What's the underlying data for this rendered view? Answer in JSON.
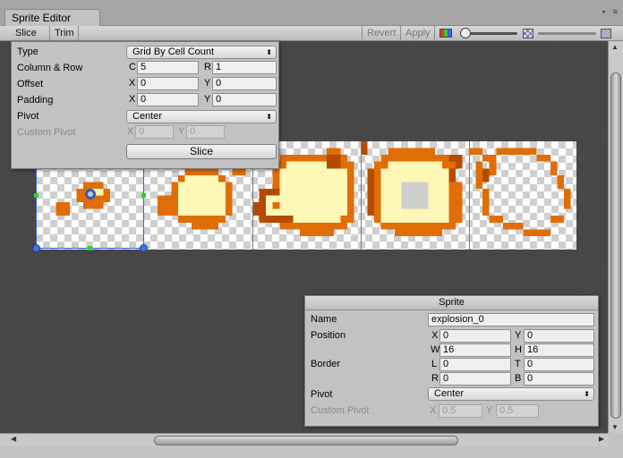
{
  "window": {
    "tab_title": "Sprite Editor"
  },
  "toolbar": {
    "slice_label": "Slice",
    "slice_arrow": "⬍",
    "trim_label": "Trim",
    "revert_label": "Revert",
    "apply_label": "Apply"
  },
  "slice_panel": {
    "type_label": "Type",
    "type_value": "Grid By Cell Count",
    "colrow_label": "Column & Row",
    "c_label": "C",
    "c_value": "5",
    "r_label": "R",
    "r_value": "1",
    "offset_label": "Offset",
    "offset_x_label": "X",
    "offset_x": "0",
    "offset_y_label": "Y",
    "offset_y": "0",
    "padding_label": "Padding",
    "padding_x_label": "X",
    "padding_x": "0",
    "padding_y_label": "Y",
    "padding_y": "0",
    "pivot_label": "Pivot",
    "pivot_value": "Center",
    "custom_pivot_label": "Custom Pivot",
    "cp_x_label": "X",
    "cp_x": "0",
    "cp_y_label": "Y",
    "cp_y": "0",
    "slice_button": "Slice"
  },
  "sprite_panel": {
    "title": "Sprite",
    "name_label": "Name",
    "name_value": "explosion_0",
    "position_label": "Position",
    "x_label": "X",
    "x_value": "0",
    "y_label": "Y",
    "y_value": "0",
    "w_label": "W",
    "w_value": "16",
    "h_label": "H",
    "h_value": "16",
    "border_label": "Border",
    "l_label": "L",
    "l_value": "0",
    "t_label": "T",
    "t_value": "0",
    "r_label": "R",
    "r_value": "0",
    "b_label": "B",
    "b_value": "0",
    "pivot_label": "Pivot",
    "pivot_value": "Center",
    "custom_pivot_label": "Custom Pivot",
    "cp_x_label": "X",
    "cp_x": "0.5",
    "cp_y_label": "Y",
    "cp_y": "0.5"
  },
  "colors": {
    "fire_orange": "#e06d06",
    "fire_dark": "#b54b00",
    "fire_light": "#fff7b5",
    "selection": "#2f62d9",
    "edge_handle": "#27d627"
  },
  "icons": {
    "channel": "color-channel-icon",
    "zoom": "zoom-slider",
    "mip": "mip-level-icon"
  }
}
